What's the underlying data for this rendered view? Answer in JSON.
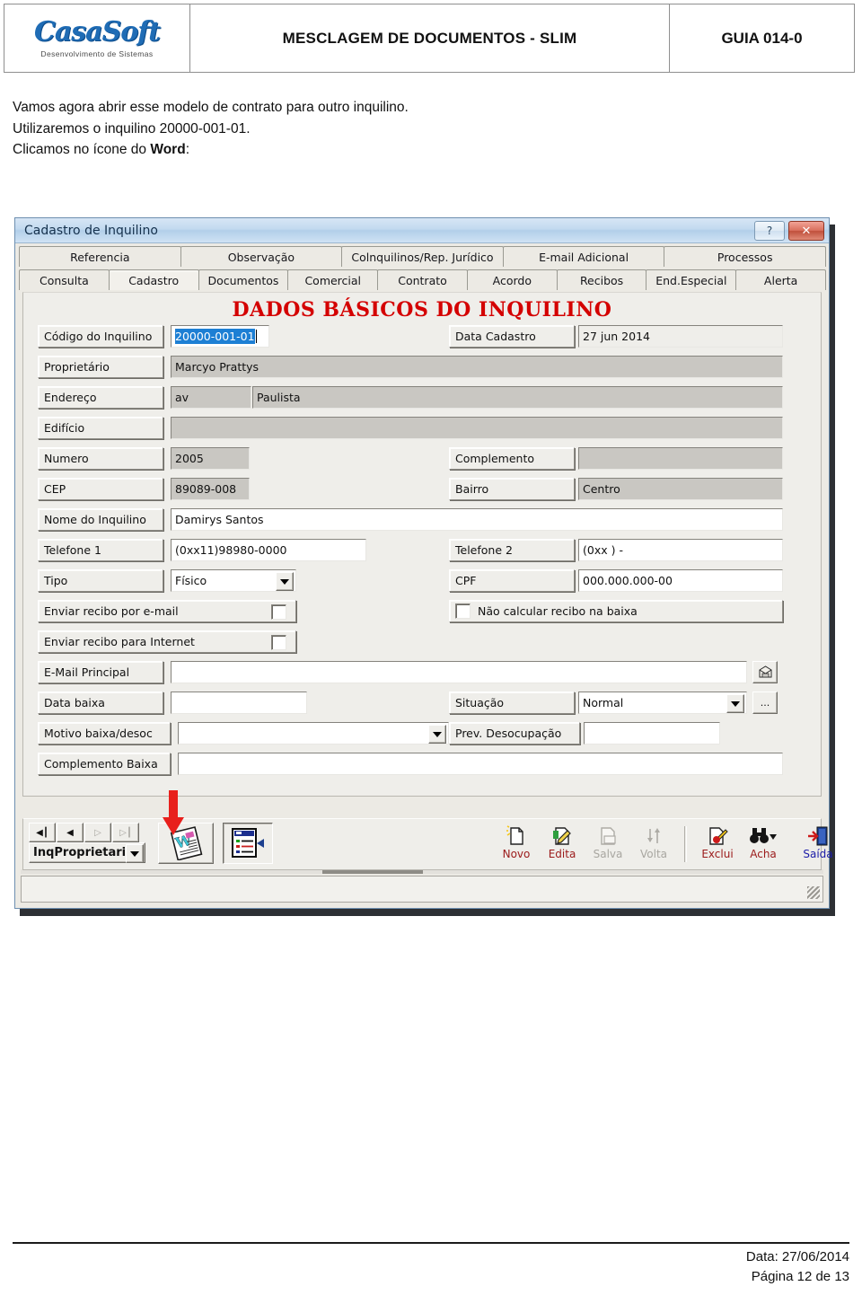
{
  "header": {
    "logo_word": "CasaSoft",
    "logo_tagline": "Desenvolvimento de Sistemas",
    "title": "MESCLAGEM DE DOCUMENTOS - SLIM",
    "guide": "GUIA 014-0"
  },
  "body": {
    "line1": "Vamos agora abrir esse modelo de contrato para outro inquilino.",
    "line2": "Utilizaremos o inquilino 20000-001-01.",
    "line3_prefix": "Clicamos no ícone do ",
    "line3_bold": "Word",
    "line3_suffix": ":"
  },
  "window": {
    "title": "Cadastro de Inquilino",
    "help_button": "?",
    "close_button": "✕",
    "tabs_top": [
      "Referencia",
      "Observação",
      "Colnquilinos/Rep. Jurídico",
      "E-mail Adicional",
      "Processos"
    ],
    "tabs_bottom": [
      "Consulta",
      "Cadastro",
      "Documentos",
      "Comercial",
      "Contrato",
      "Acordo",
      "Recibos",
      "End.Especial",
      "Alerta"
    ],
    "active_tab": "Cadastro",
    "panel_title": "DADOS BÁSICOS DO INQUILINO",
    "fields": {
      "codigo_label": "Código do Inquilino",
      "codigo_value": "20000-001-01",
      "data_cadastro_label": "Data Cadastro",
      "data_cadastro_value": "27 jun 2014",
      "proprietario_label": "Proprietário",
      "proprietario_value": "Marcyo Prattys",
      "endereco_label": "Endereço",
      "endereco_tipo_value": "av",
      "endereco_value": "Paulista",
      "edificio_label": "Edifício",
      "edificio_value": "",
      "numero_label": "Numero",
      "numero_value": "2005",
      "complemento_label": "Complemento",
      "complemento_value": "",
      "cep_label": "CEP",
      "cep_value": "89089-008",
      "bairro_label": "Bairro",
      "bairro_value": "Centro",
      "nome_label": "Nome do Inquilino",
      "nome_value": "Damirys Santos",
      "telefone1_label": "Telefone 1",
      "telefone1_value": "(0xx11)98980-0000",
      "telefone2_label": "Telefone 2",
      "telefone2_value": "(0xx  )      -",
      "tipo_label": "Tipo",
      "tipo_value": "Físico",
      "cpf_label": "CPF",
      "cpf_value": "000.000.000-00",
      "recibo_email_label": "Enviar recibo por e-mail",
      "nao_calcular_label": "Não calcular recibo na baixa",
      "recibo_internet_label": "Enviar recibo para Internet",
      "email_principal_label": "E-Mail Principal",
      "email_principal_value": "",
      "data_baixa_label": "Data baixa",
      "data_baixa_value": "",
      "situacao_label": "Situação",
      "situacao_value": "Normal",
      "situacao_more_button": "...",
      "motivo_label": "Motivo baixa/desoc",
      "motivo_value": "",
      "prev_desocupacao_label": "Prev. Desocupação",
      "prev_desocupacao_value": "",
      "complemento_baixa_label": "Complemento Baixa",
      "complemento_baixa_value": ""
    },
    "toolbar": {
      "nav_first": "◀┃",
      "nav_prev": "◀",
      "nav_next": "▷",
      "nav_last": "▷┃",
      "source_combo": "InqProprietari",
      "word_button": "word-merge",
      "report_button": "report-list",
      "actions": [
        {
          "label": "Novo",
          "state": "enabled"
        },
        {
          "label": "Edita",
          "state": "enabled"
        },
        {
          "label": "Salva",
          "state": "disabled"
        },
        {
          "label": "Volta",
          "state": "disabled"
        },
        {
          "label": "Exclui",
          "state": "enabled"
        },
        {
          "label": "Acha",
          "state": "enabled"
        },
        {
          "label": "Saída",
          "state": "exit"
        }
      ]
    }
  },
  "footer": {
    "date": "Data: 27/06/2014",
    "page": "Página 12 de 13"
  },
  "colors": {
    "accent_red": "#d40000",
    "title_blue": "#1f6cb5",
    "selection_blue": "#1d7fd4",
    "arrow_red": "#e8201c"
  }
}
